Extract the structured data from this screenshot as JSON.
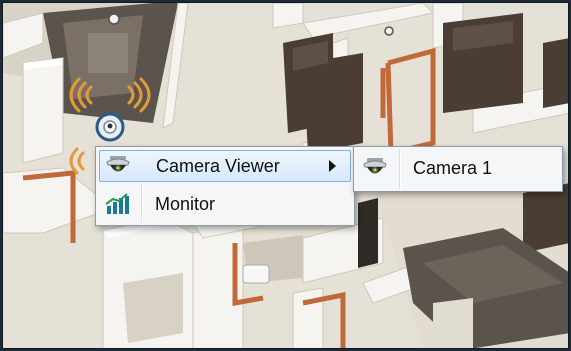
{
  "main_menu": {
    "items": [
      {
        "label": "Camera Viewer",
        "icon": "dome-camera-icon",
        "has_submenu": true,
        "highlighted": true
      },
      {
        "label": "Monitor",
        "icon": "bar-chart-icon",
        "has_submenu": false,
        "highlighted": false
      }
    ]
  },
  "sub_menu": {
    "items": [
      {
        "label": "Camera 1",
        "icon": "dome-camera-icon"
      }
    ]
  },
  "colors": {
    "menu_highlight_border": "#7fb0e6",
    "menu_background": "#f5f6f8",
    "signal_wave": "#e39a3a",
    "wall_top": "#f4f2ee",
    "floor": "#e9e4da",
    "furniture_dark": "#4a3d33",
    "door_frame": "#c06a3a"
  }
}
